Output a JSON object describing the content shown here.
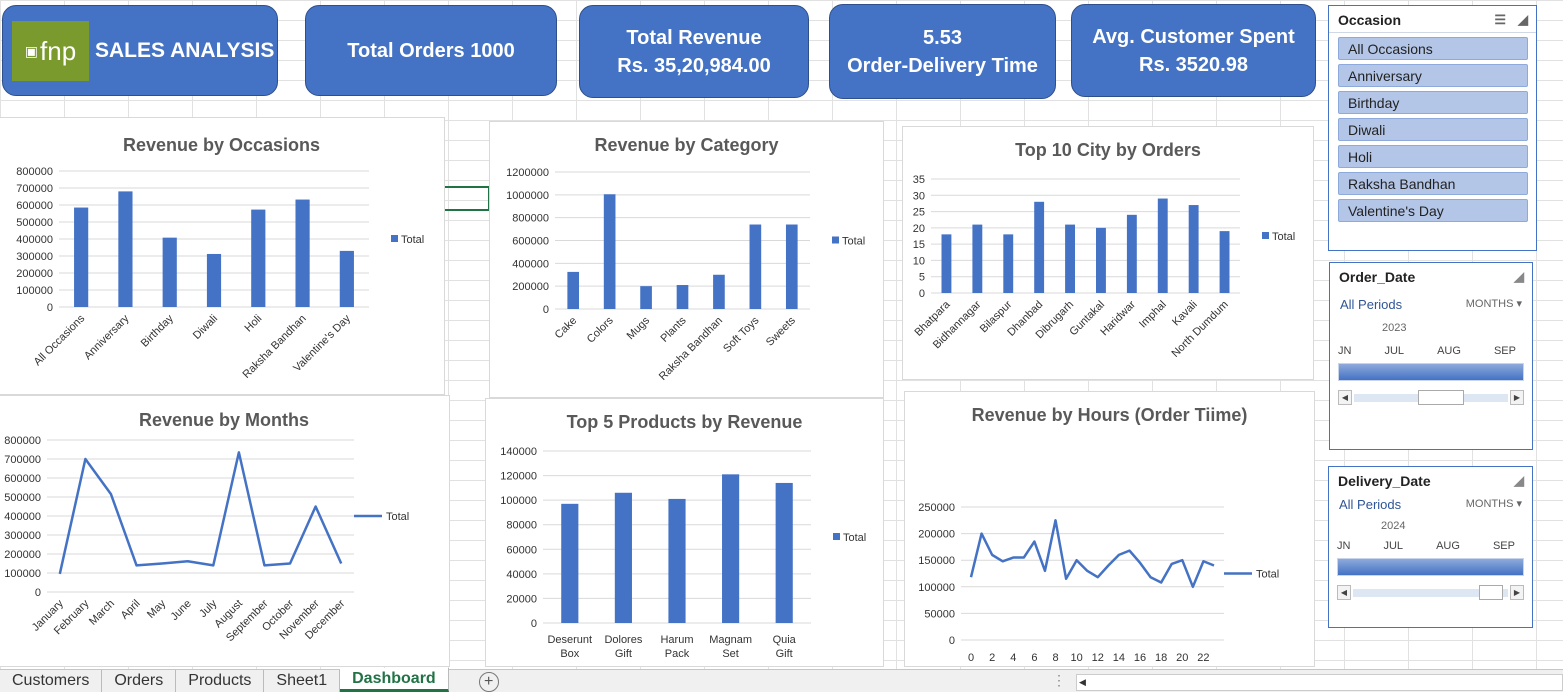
{
  "kpis": {
    "brand": "SALES ANALYSIS",
    "logo_text": "fnp",
    "total_orders": "Total Orders 1000",
    "revenue_label": "Total Revenue",
    "revenue_value": "Rs. 35,20,984.00",
    "delivery_value": "5.53",
    "delivery_label": "Order-Delivery Time",
    "avg_label": "Avg. Customer Spent",
    "avg_value": "Rs. 3520.98"
  },
  "legend_label": "Total",
  "chart_data": [
    {
      "id": "occasions",
      "type": "bar",
      "title": "Revenue by Occasions",
      "categories": [
        "All Occasions",
        "Anniversary",
        "Birthday",
        "Diwali",
        "Holi",
        "Raksha Bandhan",
        "Valentine's Day"
      ],
      "series": [
        {
          "name": "Total",
          "values": [
            585000,
            680000,
            408000,
            312000,
            573000,
            632000,
            330000
          ]
        }
      ],
      "ylim": [
        0,
        800000
      ],
      "yticks": [
        0,
        100000,
        200000,
        300000,
        400000,
        500000,
        600000,
        700000,
        800000
      ],
      "color": "#4472c4"
    },
    {
      "id": "category",
      "type": "bar",
      "title": "Revenue by Category",
      "categories": [
        "Cake",
        "Colors",
        "Mugs",
        "Plants",
        "Raksha Bandhan",
        "Soft Toys",
        "Sweets"
      ],
      "series": [
        {
          "name": "Total",
          "values": [
            325000,
            1005000,
            200000,
            210000,
            300000,
            740000,
            740000
          ]
        }
      ],
      "ylim": [
        0,
        1200000
      ],
      "yticks": [
        0,
        200000,
        400000,
        600000,
        800000,
        1000000,
        1200000
      ],
      "color": "#4472c4"
    },
    {
      "id": "city",
      "type": "bar",
      "title": "Top 10 City by Orders",
      "categories": [
        "Bhatpara",
        "Bidhannagar",
        "Bilaspur",
        "Dhanbad",
        "Dibrugarh",
        "Guntakal",
        "Haridwar",
        "Imphal",
        "Kavali",
        "North Dumdum"
      ],
      "series": [
        {
          "name": "Total",
          "values": [
            18,
            21,
            18,
            28,
            21,
            20,
            24,
            29,
            27,
            19
          ]
        }
      ],
      "ylim": [
        0,
        35
      ],
      "yticks": [
        0,
        5,
        10,
        15,
        20,
        25,
        30,
        35
      ],
      "color": "#4472c4"
    },
    {
      "id": "months",
      "type": "line",
      "title": "Revenue by Months",
      "categories": [
        "January",
        "February",
        "March",
        "April",
        "May",
        "June",
        "July",
        "August",
        "September",
        "October",
        "November",
        "December"
      ],
      "series": [
        {
          "name": "Total",
          "values": [
            95000,
            700000,
            515000,
            140000,
            150000,
            162000,
            140000,
            735000,
            140000,
            150000,
            450000,
            150000
          ]
        }
      ],
      "ylim": [
        0,
        800000
      ],
      "yticks": [
        0,
        100000,
        200000,
        300000,
        400000,
        500000,
        600000,
        700000,
        800000
      ],
      "color": "#4472c4"
    },
    {
      "id": "products",
      "type": "bar",
      "title": "Top 5 Products by Revenue",
      "categories": [
        "Deserunt Box",
        "Dolores Gift",
        "Harum Pack",
        "Magnam Set",
        "Quia Gift"
      ],
      "series": [
        {
          "name": "Total",
          "values": [
            97000,
            106000,
            101000,
            121000,
            114000
          ]
        }
      ],
      "ylim": [
        0,
        140000
      ],
      "yticks": [
        0,
        20000,
        40000,
        60000,
        80000,
        100000,
        120000,
        140000
      ],
      "color": "#4472c4"
    },
    {
      "id": "hours",
      "type": "line",
      "title": "Revenue by Hours (Order Tiime)",
      "x": [
        0,
        1,
        2,
        3,
        4,
        5,
        6,
        7,
        8,
        9,
        10,
        11,
        12,
        13,
        14,
        15,
        16,
        17,
        18,
        19,
        20,
        21,
        22,
        23
      ],
      "xticks": [
        0,
        2,
        4,
        6,
        8,
        10,
        12,
        14,
        16,
        18,
        20,
        22
      ],
      "series": [
        {
          "name": "Total",
          "values": [
            118000,
            200000,
            160000,
            148000,
            155000,
            155000,
            185000,
            130000,
            225000,
            115000,
            150000,
            130000,
            118000,
            140000,
            160000,
            168000,
            145000,
            118000,
            108000,
            143000,
            150000,
            100000,
            148000,
            140000
          ]
        }
      ],
      "ylim": [
        0,
        250000
      ],
      "yticks": [
        0,
        50000,
        100000,
        150000,
        200000,
        250000
      ],
      "color": "#4472c4"
    }
  ],
  "slicers": {
    "occasion": {
      "title": "Occasion",
      "items": [
        "All Occasions",
        "Anniversary",
        "Birthday",
        "Diwali",
        "Holi",
        "Raksha Bandhan",
        "Valentine's Day"
      ]
    },
    "order_date": {
      "title": "Order_Date",
      "all_periods": "All Periods",
      "level": "MONTHS",
      "year": "2023",
      "months": [
        "JN",
        "JUL",
        "AUG",
        "SEP"
      ]
    },
    "delivery_date": {
      "title": "Delivery_Date",
      "all_periods": "All Periods",
      "level": "MONTHS",
      "year": "2024",
      "months": [
        "JN",
        "JUL",
        "AUG",
        "SEP"
      ]
    }
  },
  "sheet_tabs": [
    "Customers",
    "Orders",
    "Products",
    "Sheet1",
    "Dashboard"
  ],
  "active_tab": "Dashboard"
}
